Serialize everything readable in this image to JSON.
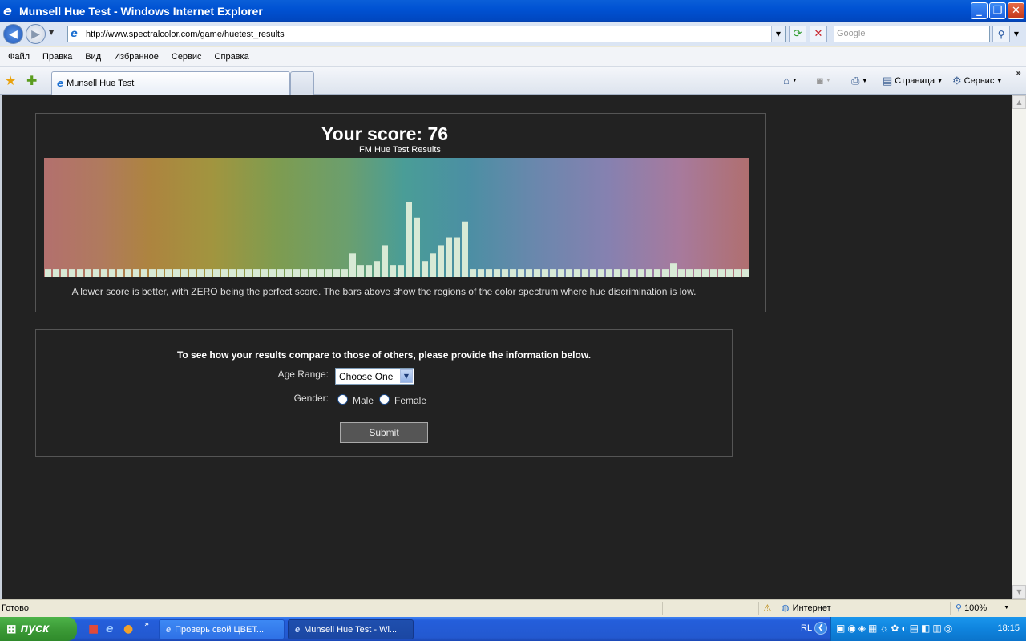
{
  "window": {
    "title": "Munsell Hue Test - Windows Internet Explorer",
    "controls": {
      "minimize": "_",
      "maximize": "❐",
      "close": "✕"
    }
  },
  "address": {
    "url": "http://www.spectralcolor.com/game/huetest_results",
    "search_placeholder": "Google"
  },
  "menu": {
    "items": [
      "Файл",
      "Правка",
      "Вид",
      "Избранное",
      "Сервис",
      "Справка"
    ]
  },
  "tabs": {
    "active_label": "Munsell Hue Test"
  },
  "commands": {
    "page_label": "Страница",
    "tools_label": "Сервис"
  },
  "results": {
    "score": "Your score: 76",
    "chart_subtitle": "FM Hue Test Results",
    "explanation": "A lower score is better, with ZERO being the perfect score. The bars above show the regions of the color spectrum where hue discrimination is low."
  },
  "chart_data": {
    "type": "bar",
    "title": "FM Hue Test Results",
    "ylim": [
      0,
      10
    ],
    "bar_count": 88,
    "baseline": 1,
    "values": [
      1,
      1,
      1,
      1,
      1,
      1,
      1,
      1,
      1,
      1,
      1,
      1,
      1,
      1,
      1,
      1,
      1,
      1,
      1,
      1,
      1,
      1,
      1,
      1,
      1,
      1,
      1,
      1,
      1,
      1,
      1,
      1,
      1,
      1,
      1,
      1,
      1,
      1,
      3,
      1.5,
      1.5,
      2,
      4,
      1.5,
      1.5,
      9.5,
      7.5,
      2,
      3,
      4,
      5,
      5,
      7,
      1,
      1,
      1,
      1,
      1,
      1,
      1,
      1,
      1,
      1,
      1,
      1,
      1,
      1,
      1,
      1,
      1,
      1,
      1,
      1,
      1,
      1,
      1,
      1,
      1,
      1.8,
      1,
      1,
      1,
      1,
      1,
      1,
      1,
      1,
      1
    ],
    "colors": {
      "bar": "#d8ead6",
      "spectrum_start": "#b3706e",
      "spectrum_end": "#b06f6f"
    }
  },
  "form": {
    "prompt": "To see how your results compare to those of others, please provide the information below.",
    "age_label": "Age Range:",
    "age_value": "Choose One",
    "gender_label": "Gender:",
    "male_label": "Male",
    "female_label": "Female",
    "submit_label": "Submit"
  },
  "status": {
    "text": "Готово",
    "zone": "Интернет",
    "zoom": "100%"
  },
  "taskbar": {
    "start_label": "пуск",
    "items": [
      "Проверь свой ЦВЕТ...",
      "Munsell Hue Test - Wi..."
    ],
    "language": "RL",
    "clock": "18:15"
  }
}
